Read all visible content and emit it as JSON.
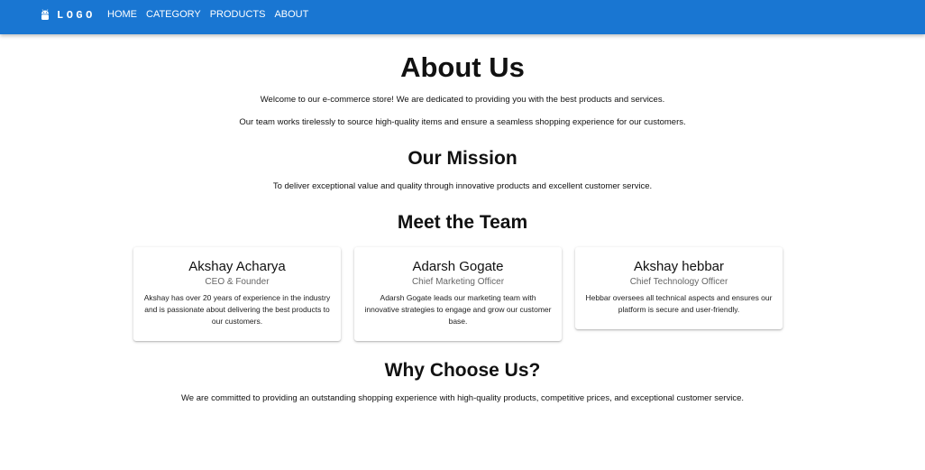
{
  "header": {
    "logo_text": "LOGO",
    "nav": [
      "HOME",
      "CATEGORY",
      "PRODUCTS",
      "ABOUT"
    ],
    "color": "#1976d2"
  },
  "about": {
    "title": "About Us",
    "intro_1": "Welcome to our e-commerce store! We are dedicated to providing you with the best products and services.",
    "intro_2": "Our team works tirelessly to source high-quality items and ensure a seamless shopping experience for our customers."
  },
  "mission": {
    "title": "Our Mission",
    "text": "To deliver exceptional value and quality through innovative products and excellent customer service."
  },
  "team": {
    "title": "Meet the Team",
    "members": [
      {
        "name": "Akshay Acharya",
        "role": "CEO & Founder",
        "bio": "Akshay has over 20 years of experience in the industry and is passionate about delivering the best products to our customers."
      },
      {
        "name": "Adarsh Gogate",
        "role": "Chief Marketing Officer",
        "bio": "Adarsh Gogate leads our marketing team with innovative strategies to engage and grow our customer base."
      },
      {
        "name": "Akshay hebbar",
        "role": "Chief Technology Officer",
        "bio": "Hebbar oversees all technical aspects and ensures our platform is secure and user-friendly."
      }
    ]
  },
  "why": {
    "title": "Why Choose Us?",
    "text": "We are committed to providing an outstanding shopping experience with high-quality products, competitive prices, and exceptional customer service."
  }
}
